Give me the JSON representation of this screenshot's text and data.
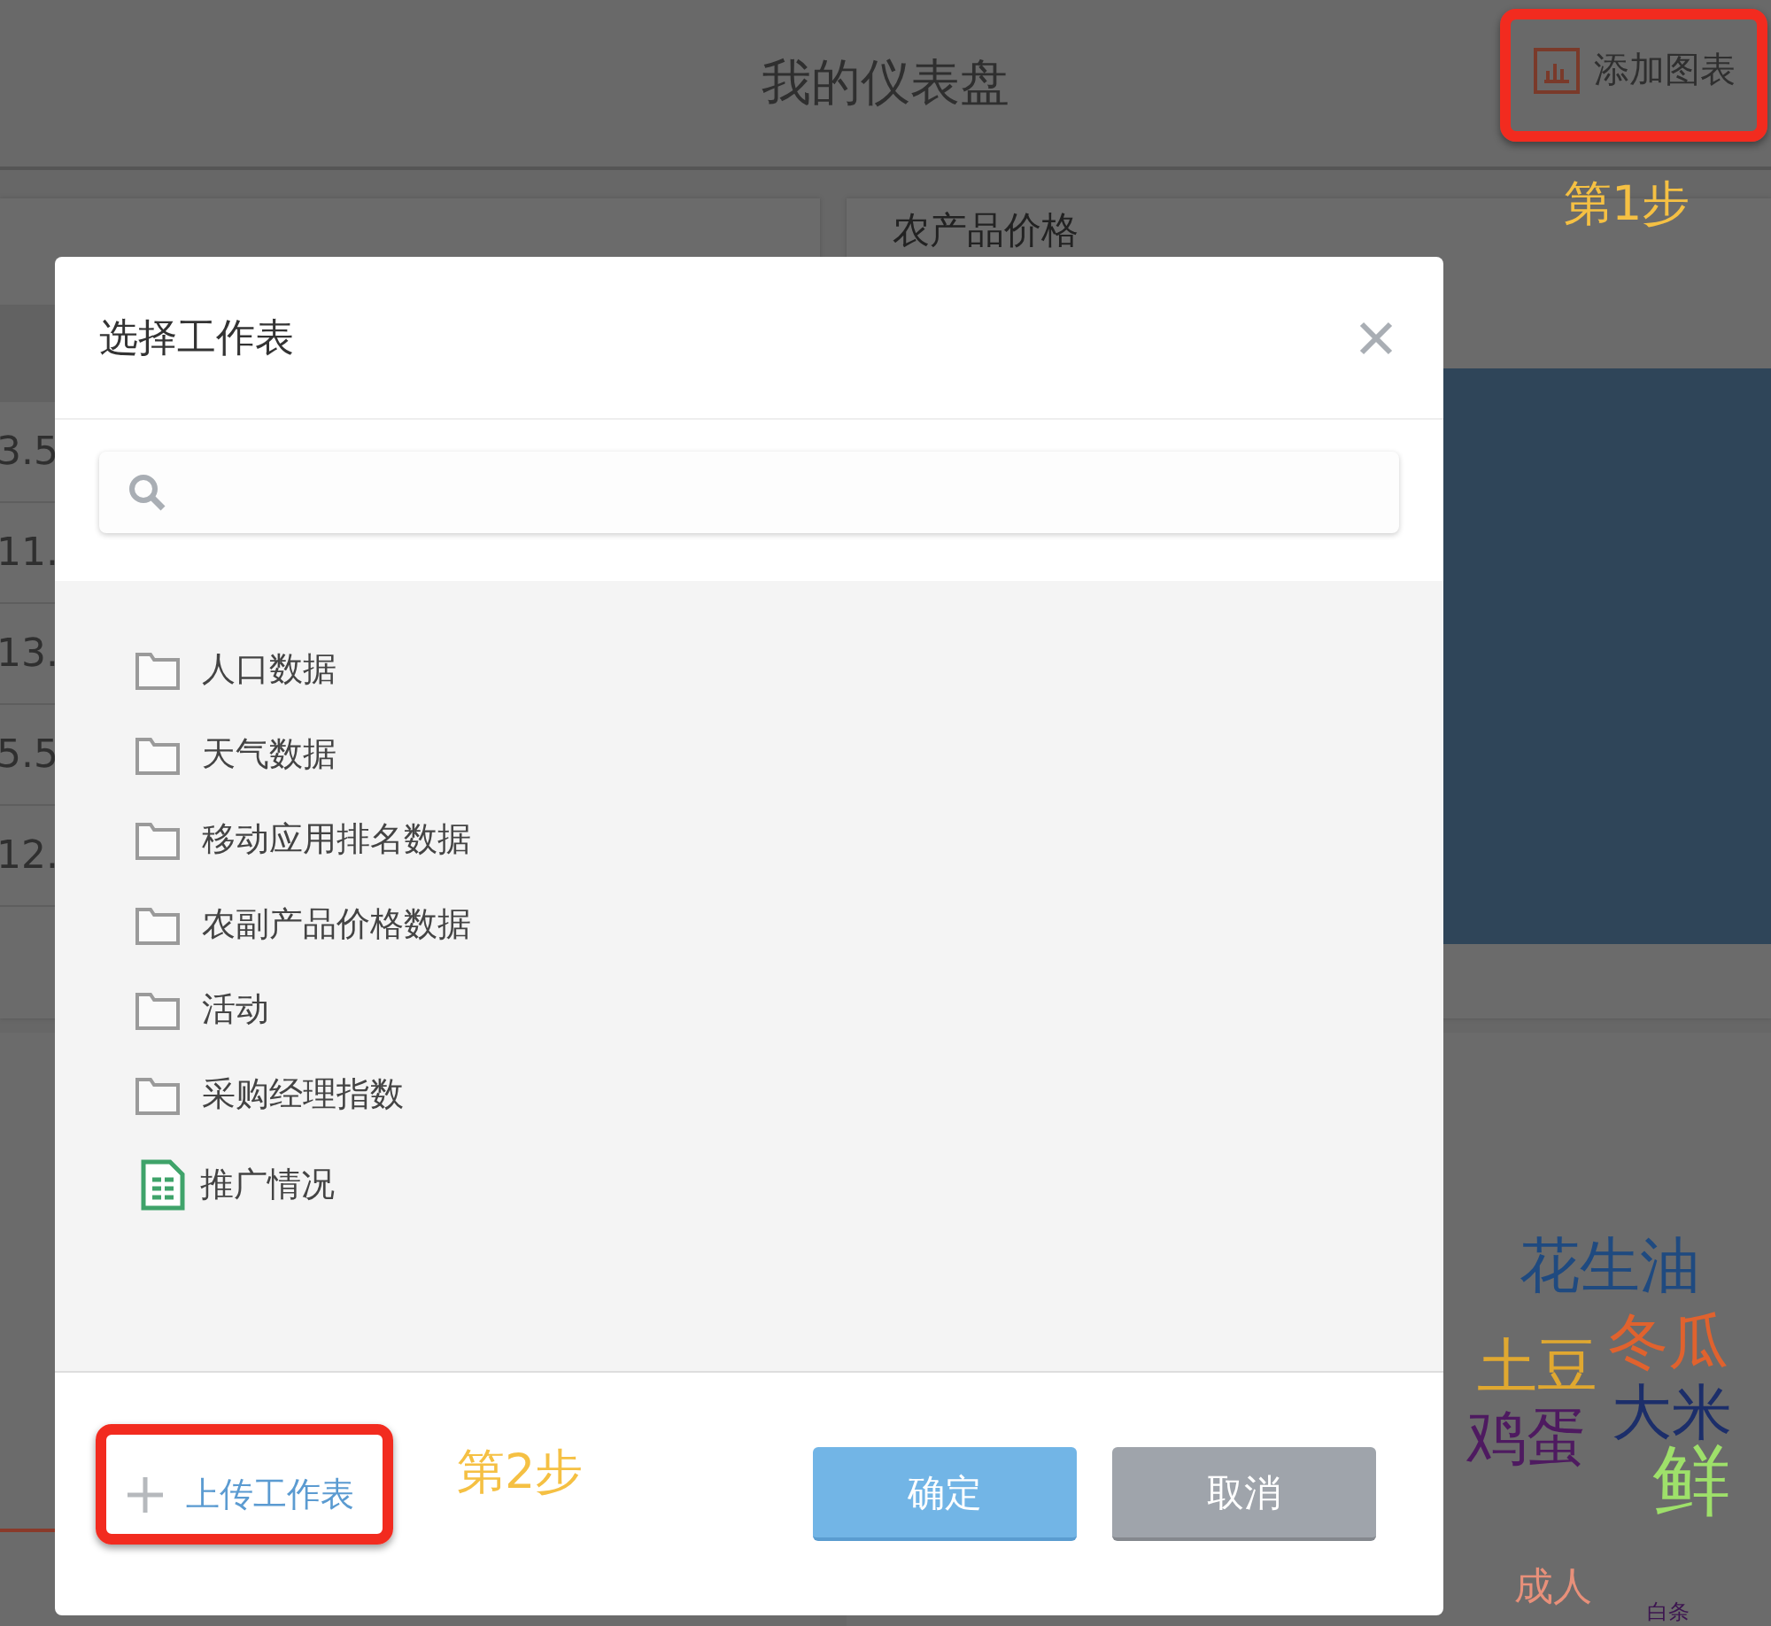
{
  "header": {
    "title": "我的仪表盘",
    "add_chart_button": "添加图表"
  },
  "table_panel": {
    "cells": [
      "3.5",
      "11.",
      "13.",
      "5.5",
      "12."
    ]
  },
  "chart_panel": {
    "title": "农产品价格"
  },
  "wordcloud_panel": {
    "words": [
      {
        "text": "花生油",
        "color": "#1f4a80"
      },
      {
        "text": "土豆",
        "color": "#e0a830"
      },
      {
        "text": "冬瓜",
        "color": "#e0622e"
      },
      {
        "text": "大米",
        "color": "#1c2e6a"
      },
      {
        "text": "鸡蛋",
        "color": "#4e1a60"
      },
      {
        "text": "鲜",
        "color": "#9ee06a"
      },
      {
        "text": "成人",
        "color": "#e8907a"
      },
      {
        "text": "白条",
        "color": "#3c1450"
      }
    ]
  },
  "dialog": {
    "title": "选择工作表",
    "items": [
      {
        "label": "人口数据",
        "kind": "folder"
      },
      {
        "label": "天气数据",
        "kind": "folder"
      },
      {
        "label": "移动应用排名数据",
        "kind": "folder"
      },
      {
        "label": "农副产品价格数据",
        "kind": "folder"
      },
      {
        "label": "活动",
        "kind": "folder"
      },
      {
        "label": "采购经理指数",
        "kind": "folder"
      },
      {
        "label": "推广情况",
        "kind": "sheet"
      }
    ],
    "upload_link": "上传工作表",
    "buttons": [
      {
        "label": "确定",
        "kind": "primary"
      },
      {
        "label": "取消",
        "kind": "secondary"
      }
    ]
  },
  "annotations": [
    {
      "label": "第1步"
    },
    {
      "label": "第2步"
    }
  ]
}
